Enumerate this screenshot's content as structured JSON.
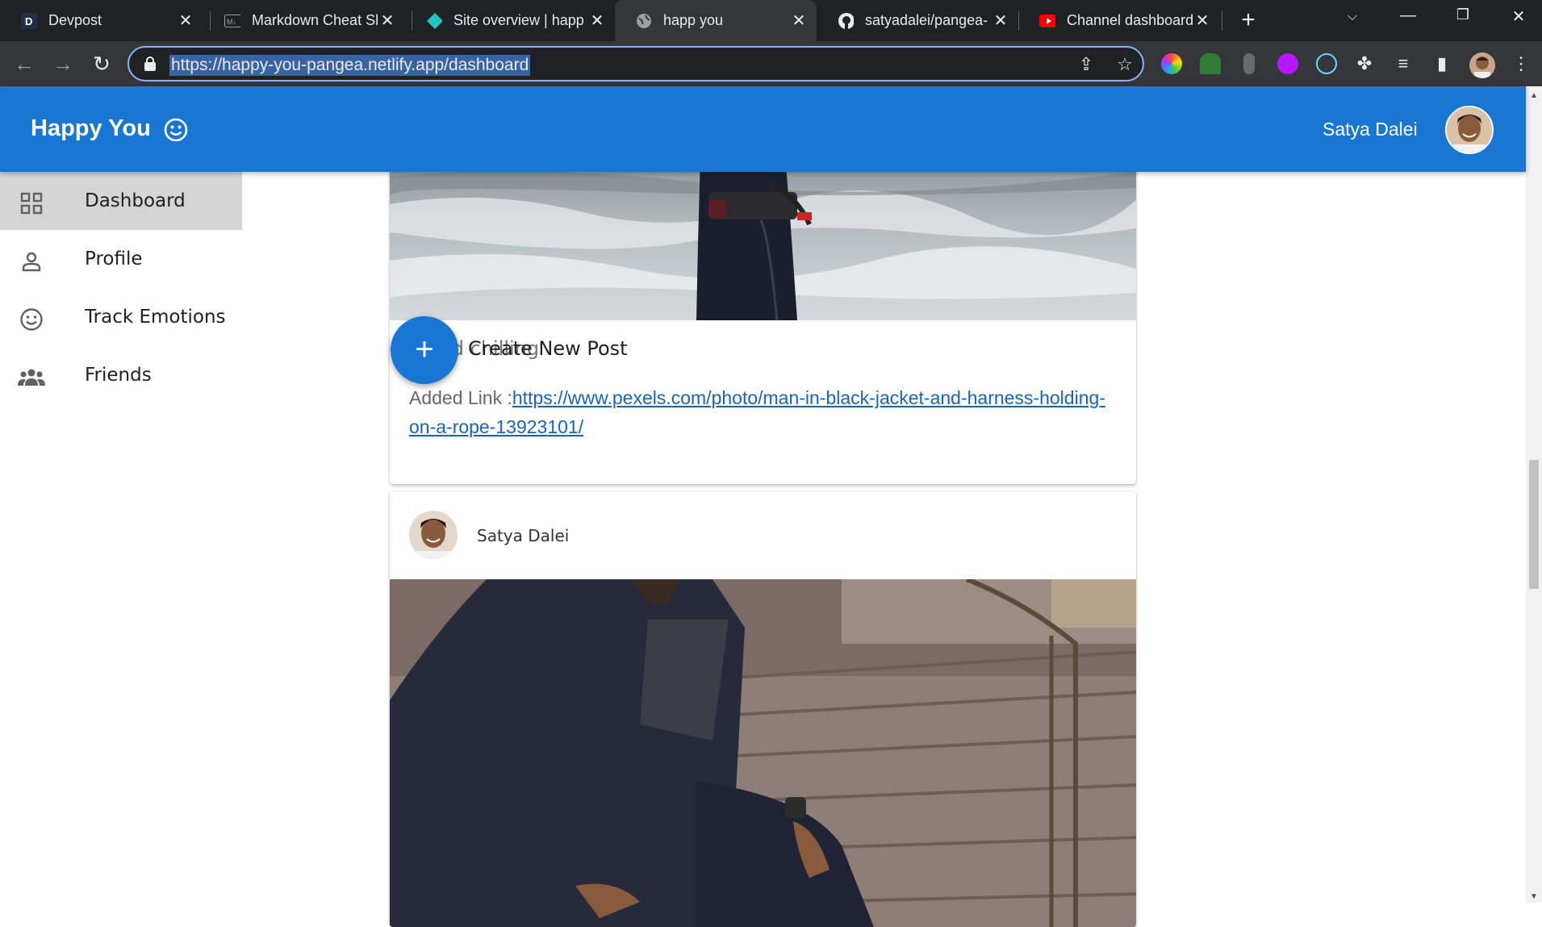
{
  "browser": {
    "tabs": [
      {
        "title": "Devpost",
        "icon": "devpost-icon"
      },
      {
        "title": "Markdown Cheat Sheet",
        "icon": "markdown-icon"
      },
      {
        "title": "Site overview | happ",
        "icon": "netlify-icon"
      },
      {
        "title": "happ you",
        "icon": "globe-icon"
      },
      {
        "title": "satyadalei/pangea-",
        "icon": "github-icon"
      },
      {
        "title": "Channel dashboard",
        "icon": "youtube-icon"
      }
    ],
    "active_tab": 3,
    "url": "https://happy-you-pangea.netlify.app/dashboard"
  },
  "app": {
    "brand": "Happy You",
    "user_name": "Satya Dalei",
    "accent_color": "#1976d2"
  },
  "sidebar": {
    "items": [
      {
        "label": "Dashboard",
        "icon": "dashboard-icon",
        "selected": true
      },
      {
        "label": "Profile",
        "icon": "person-icon",
        "selected": false
      },
      {
        "label": "Track Emotions",
        "icon": "smiley-icon",
        "selected": false
      },
      {
        "label": "Friends",
        "icon": "group-icon",
        "selected": false
      }
    ]
  },
  "feed": {
    "fab_label": "Create New Post",
    "posts": [
      {
        "caption": "g and chilling",
        "link_prefix": "Added Link :",
        "link": "https://www.pexels.com/photo/man-in-black-jacket-and-harness-holding-on-a-rope-13923101/"
      },
      {
        "author": "Satya Dalei"
      }
    ]
  }
}
